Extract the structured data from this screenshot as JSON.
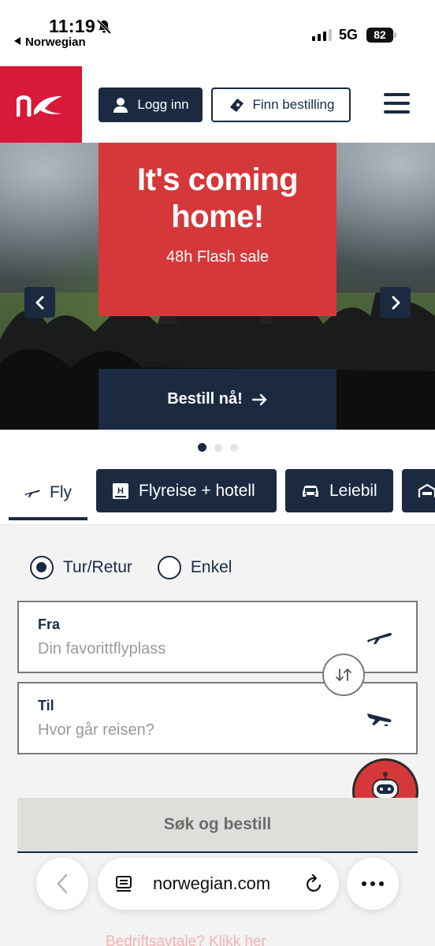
{
  "status_bar": {
    "time": "11:19",
    "back_app": "Norwegian",
    "network": "5G",
    "battery": "82"
  },
  "header": {
    "login_label": "Logg inn",
    "find_booking_label": "Finn bestilling"
  },
  "hero": {
    "title": "It's coming home!",
    "subtitle": "48h Flash sale",
    "cta_label": "Bestill nå!",
    "slide_count": 3,
    "active_slide": 1
  },
  "tabs": [
    {
      "label": "Fly",
      "icon": "plane-icon",
      "active": true
    },
    {
      "label": "Flyreise + hotell",
      "icon": "hotel-icon",
      "active": false
    },
    {
      "label": "Leiebil",
      "icon": "car-icon",
      "active": false
    }
  ],
  "trip_type": {
    "round_trip_label": "Tur/Retur",
    "one_way_label": "Enkel",
    "selected": "Tur/Retur"
  },
  "from_field": {
    "label": "Fra",
    "placeholder": "Din favorittflyplass"
  },
  "to_field": {
    "label": "Til",
    "placeholder": "Hvor går reisen?"
  },
  "submit_label": "Søk og bestill",
  "corporate_link": "Bedriftsavtale? Klikk her",
  "browser": {
    "url": "norwegian.com"
  },
  "colors": {
    "brand_red": "#d81939",
    "navy": "#1b2a41",
    "promo_red": "#d5383a"
  }
}
